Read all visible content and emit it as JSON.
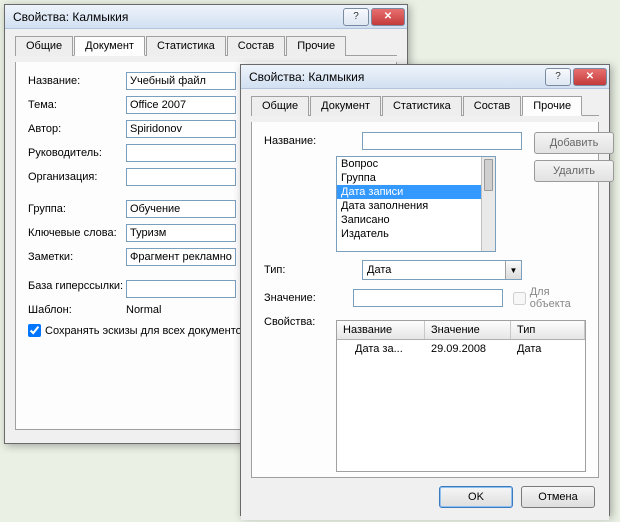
{
  "dialog1": {
    "title": "Свойства: Калмыкия",
    "tabs": [
      "Общие",
      "Документ",
      "Статистика",
      "Состав",
      "Прочие"
    ],
    "active_tab": 1,
    "fields": {
      "name_label": "Название:",
      "name_value": "Учебный файл",
      "subject_label": "Тема:",
      "subject_value": "Office 2007",
      "author_label": "Автор:",
      "author_value": "Spiridonov",
      "manager_label": "Руководитель:",
      "manager_value": "",
      "org_label": "Организация:",
      "org_value": "",
      "group_label": "Группа:",
      "group_value": "Обучение",
      "keywords_label": "Ключевые слова:",
      "keywords_value": "Туризм",
      "notes_label": "Заметки:",
      "notes_value": "Фрагмент рекламно",
      "hyperlink_label": "База гиперссылки:",
      "hyperlink_value": "",
      "template_label": "Шаблон:",
      "template_value": "Normal"
    },
    "save_thumb_label": "Сохранять эскизы для всех документо",
    "save_thumb_checked": true
  },
  "dialog2": {
    "title": "Свойства: Калмыкия",
    "tabs": [
      "Общие",
      "Документ",
      "Статистика",
      "Состав",
      "Прочие"
    ],
    "active_tab": 4,
    "name_label": "Название:",
    "name_value": "",
    "list_items": [
      "Вопрос",
      "Группа",
      "Дата записи",
      "Дата заполнения",
      "Записано",
      "Издатель"
    ],
    "list_selected_index": 2,
    "type_label": "Тип:",
    "type_value": "Дата",
    "value_label": "Значение:",
    "value_value": "",
    "for_object_label": "Для объекта",
    "props_label": "Свойства:",
    "add_btn": "Добавить",
    "del_btn": "Удалить",
    "table": {
      "headers": [
        "Название",
        "Значение",
        "Тип"
      ],
      "rows": [
        {
          "name": "Дата за...",
          "value": "29.09.2008",
          "type": "Дата"
        }
      ]
    },
    "ok_btn": "OK",
    "cancel_btn": "Отмена"
  }
}
